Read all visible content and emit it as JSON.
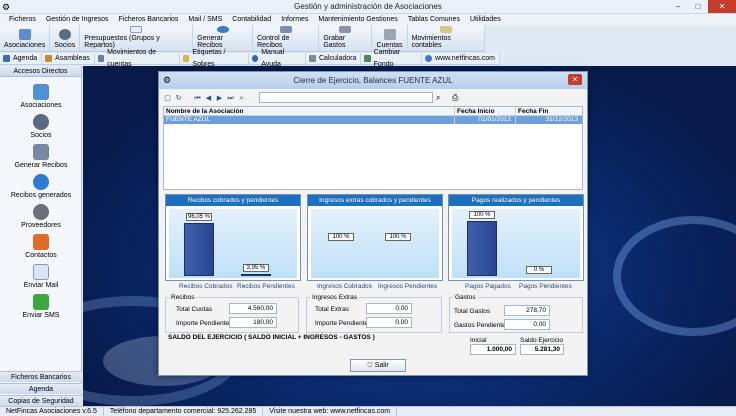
{
  "window": {
    "title": "Gestión y administración de Asociaciones"
  },
  "menu": [
    "Ficheros",
    "Gestión de Ingresos",
    "Ficheros Bancarios",
    "Mail / SMS",
    "Contabilidad",
    "Informes",
    "Mantenimiento Gestiones",
    "Tablas Comunes",
    "Utilidades"
  ],
  "toolbar": [
    "Asociaciones",
    "Socios",
    "Presupuestos (Grupos y Repartos)",
    "Generar Recibos",
    "Control de Recibos",
    "Grabar Gastos",
    "Cuentas",
    "Movimientos contables"
  ],
  "toolbar2": [
    "Agenda",
    "Asambleas",
    "Movimientos de cuentas",
    "Etiquetas / Sobres",
    "Manual Ayuda",
    "Calculadora",
    "Cambiar Fondo",
    "www.netfincas.com"
  ],
  "sidebar": {
    "header": "Accesos Directos",
    "items": [
      "Asociaciones",
      "Socios",
      "Generar Recibos",
      "Recibos generados",
      "Proveedores",
      "Contactos",
      "Enviar Mail",
      "Enviar SMS"
    ],
    "footer": [
      "Ficheros Bancarios",
      "Agenda",
      "Copias de Seguridad"
    ]
  },
  "status": [
    "NetFincas Asociaciones v.6.5",
    "Teléfono departamento comercial: 925.262.285",
    "Visite nuestra web: www.netfincas.com"
  ],
  "dialog": {
    "title": "Cierre de Ejercicio, Balances FUENTE AZUL",
    "search_value": "",
    "table": {
      "headers": [
        "Nombre de la Asociación",
        "Fecha Inicio",
        "Fecha Fin"
      ],
      "rows": [
        [
          "FUENTE AZUL",
          "01/01/2012",
          "31/12/2013"
        ]
      ]
    },
    "salir": "Salir"
  },
  "chart_data": [
    {
      "type": "bar",
      "title": "Recibos cobrados y pendientes",
      "categories": [
        "Recibos Cobrados",
        "Recibos Pendientes"
      ],
      "values": [
        96.05,
        3.95
      ],
      "labels": [
        "96,05 %",
        "3,95 %"
      ],
      "ylim": [
        0,
        100
      ]
    },
    {
      "type": "bar",
      "title": "Ingresos extras cobrados y pendientes",
      "categories": [
        "Ingresos Cobrados",
        "Ingresos Pendientes"
      ],
      "values": [
        0,
        0
      ],
      "labels": [
        "100 %",
        "100 %"
      ],
      "ylim": [
        0,
        100
      ]
    },
    {
      "type": "bar",
      "title": "Pagos realizados y pendientes",
      "categories": [
        "Pagos Pagados",
        "Pagos Pendientes"
      ],
      "values": [
        100,
        0
      ],
      "labels": [
        "100 %",
        "0 %"
      ],
      "ylim": [
        0,
        100
      ]
    }
  ],
  "summary": {
    "recibos": {
      "title": "Recibos",
      "total_label": "Total Cuotas",
      "total": "4.560,00",
      "pend_label": "Importe Pendiente",
      "pend": "180,00"
    },
    "ingresos": {
      "title": "Ingresos Extras",
      "total_label": "Total Extras",
      "total": "0,00",
      "pend_label": "Importe Pendiente",
      "pend": "0,00"
    },
    "gastos": {
      "title": "Gastos",
      "total_label": "Total Gastos",
      "total": "278,70",
      "pend_label": "Gastos Pendientes",
      "pend": "0,00"
    },
    "saldo": {
      "title": "SALDO DEL EJERCICIO ( SALDO INICIAL + INGRESOS - GASTOS )",
      "inicial_label": "Inicial",
      "inicial": "1.000,00",
      "saldo_label": "Saldo Ejercicio",
      "saldo": "5.281,30"
    }
  },
  "colors": {
    "accent": "#1f6fbf",
    "bar": "#3f5fad",
    "selection": "#6e9fdd",
    "close": "#c73a2e"
  }
}
